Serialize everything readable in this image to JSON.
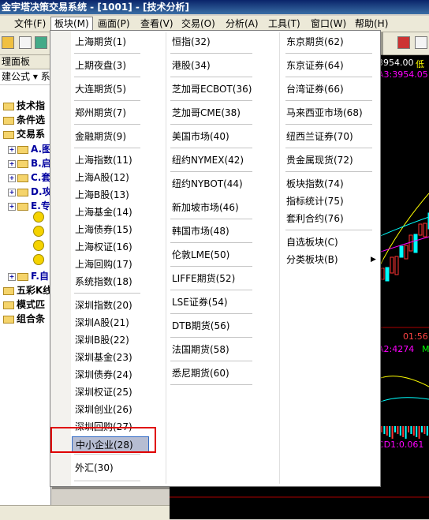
{
  "window": {
    "title": "金宇塔决策交易系统 - [1001] - [技术分析]"
  },
  "menubar": {
    "items": [
      "文件(F)",
      "板块(M)",
      "画面(P)",
      "查看(V)",
      "交易(O)",
      "分析(A)",
      "工具(T)",
      "窗口(W)",
      "帮助(H)"
    ],
    "active": "板块(M)"
  },
  "left_panel": {
    "header": "理面板",
    "combo": "建公式 ▾ 系",
    "tree": [
      {
        "label": "技术指",
        "kind": "folder"
      },
      {
        "label": "条件选",
        "kind": "folder"
      },
      {
        "label": "交易系",
        "kind": "folder"
      },
      {
        "label": "A.图",
        "kind": "sub"
      },
      {
        "label": "B.启",
        "kind": "sub"
      },
      {
        "label": "C.套",
        "kind": "sub"
      },
      {
        "label": "D.攻",
        "kind": "sub"
      },
      {
        "label": "E.专",
        "kind": "sub"
      },
      {
        "label": "F.自",
        "kind": "sub"
      },
      {
        "label": "五彩K线",
        "kind": "folder"
      },
      {
        "label": "模式匹",
        "kind": "folder"
      },
      {
        "label": "组合条",
        "kind": "folder"
      }
    ]
  },
  "chart_labels": {
    "price": "3954.00",
    "low_label": "低",
    "ma3": "A3:3954.05",
    "time": "01:56",
    "ma2": "A2:4274",
    "cd1": "CD1:0.061",
    "m": "M"
  },
  "dropdown": {
    "col1": [
      "上海期货(1)",
      "上期夜盘(3)",
      "大连期货(5)",
      "郑州期货(7)",
      "金融期货(9)",
      "上海指数(11)",
      "上海A股(12)",
      "上海B股(13)",
      "上海基金(14)",
      "上海债券(15)",
      "上海权证(16)",
      "上海回购(17)",
      "系统指数(18)",
      "深圳指数(20)",
      "深圳A股(21)",
      "深圳B股(22)",
      "深圳基金(23)",
      "深圳债券(24)",
      "深圳权证(25)",
      "深圳创业(26)",
      "深圳回购(27)",
      "中小企业(28)",
      "外汇(30)"
    ],
    "col2": [
      "恒指(32)",
      "港股(34)",
      "芝加哥ECBOT(36)",
      "芝加哥CME(38)",
      "美国市场(40)",
      "纽约NYMEX(42)",
      "纽约NYBOT(44)",
      "新加坡市场(46)",
      "韩国市场(48)",
      "伦敦LME(50)",
      "LIFFE期货(52)",
      "LSE证券(54)",
      "DTB期货(56)",
      "法国期货(58)",
      "悉尼期货(60)"
    ],
    "col3": [
      "东京期货(62)",
      "东京证券(64)",
      "台湾证券(66)",
      "马来西亚市场(68)",
      "纽西兰证券(70)",
      "贵金属现货(72)",
      "板块指数(74)",
      "指标统计(75)",
      "套利合约(76)",
      "自选板块(C)",
      "分类板块(B)"
    ],
    "selected": "中小企业(28)",
    "submenu_item": "分类板块(B)",
    "submenu_arrow": "▶"
  },
  "colors": {
    "selection_bg": "#b6bdd2",
    "highlight_box": "#e00000",
    "chart_bg": "#000000"
  }
}
